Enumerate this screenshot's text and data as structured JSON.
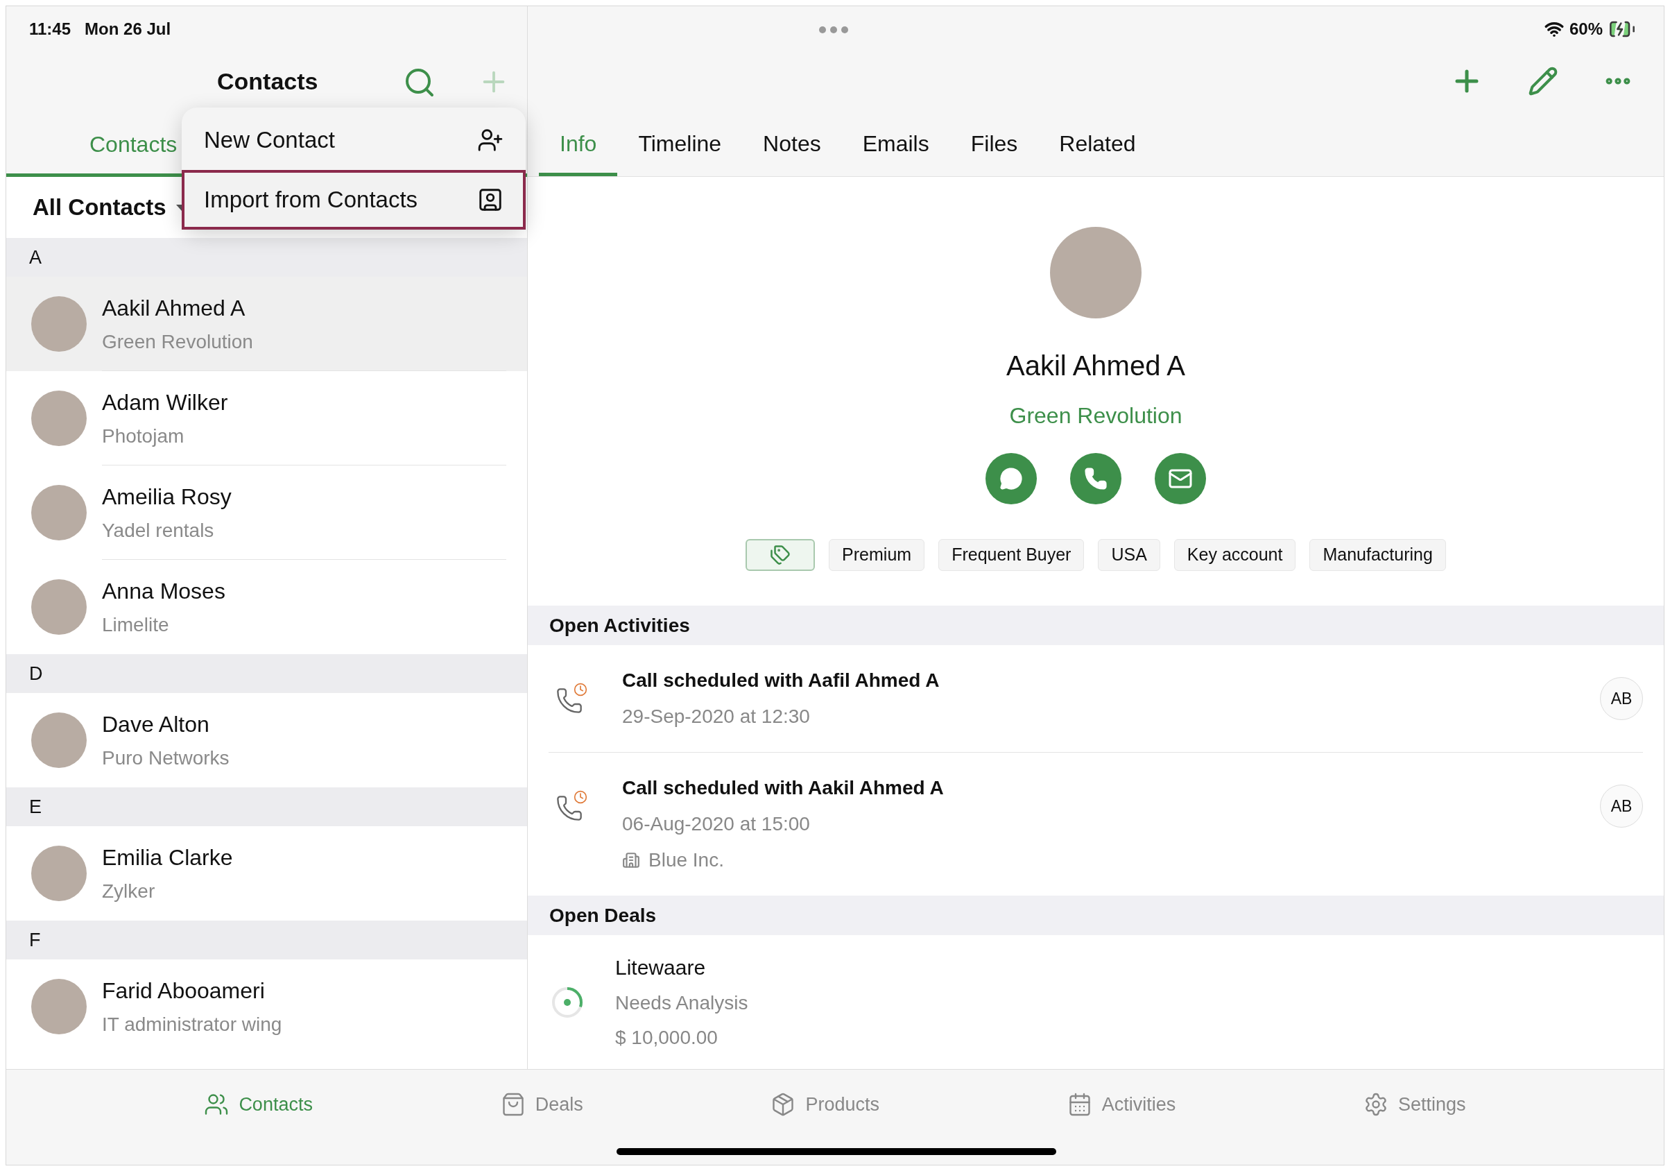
{
  "status_bar": {
    "time": "11:45",
    "date": "Mon 26 Jul",
    "battery": "60%"
  },
  "list_pane": {
    "title": "Contacts",
    "tabs": [
      {
        "label": "Contacts",
        "selected": true
      }
    ],
    "filter": "All Contacts",
    "sections": [
      {
        "letter": "A",
        "contacts": [
          {
            "name": "Aakil Ahmed A",
            "company": "Green Revolution",
            "selected": true
          },
          {
            "name": "Adam Wilker",
            "company": "Photojam",
            "selected": false
          },
          {
            "name": "Ameilia Rosy",
            "company": "Yadel rentals",
            "selected": false
          },
          {
            "name": "Anna Moses",
            "company": "Limelite",
            "selected": false
          }
        ]
      },
      {
        "letter": "D",
        "contacts": [
          {
            "name": "Dave Alton",
            "company": "Puro Networks",
            "selected": false
          }
        ]
      },
      {
        "letter": "E",
        "contacts": [
          {
            "name": "Emilia Clarke",
            "company": "Zylker",
            "selected": false
          }
        ]
      },
      {
        "letter": "F",
        "contacts": [
          {
            "name": "Farid Abooameri",
            "company": "IT administrator wing",
            "selected": false
          }
        ]
      }
    ]
  },
  "add_menu": {
    "items": [
      {
        "label": "New Contact",
        "selected": false
      },
      {
        "label": "Import from Contacts",
        "selected": true
      }
    ]
  },
  "detail_pane": {
    "tabs": [
      {
        "label": "Info",
        "selected": true
      },
      {
        "label": "Timeline",
        "selected": false
      },
      {
        "label": "Notes",
        "selected": false
      },
      {
        "label": "Emails",
        "selected": false
      },
      {
        "label": "Files",
        "selected": false
      },
      {
        "label": "Related",
        "selected": false
      }
    ],
    "name": "Aakil Ahmed A",
    "company": "Green Revolution",
    "tags": [
      "Premium",
      "Frequent Buyer",
      "USA",
      "Key account",
      "Manufacturing"
    ],
    "open_activities": {
      "title": "Open Activities",
      "items": [
        {
          "title": "Call scheduled with Aafil Ahmed A",
          "when": "29-Sep-2020 at 12:30",
          "owner": "AB"
        },
        {
          "title": "Call scheduled with Aakil Ahmed A",
          "when": "06-Aug-2020 at 15:00",
          "account": "Blue Inc.",
          "owner": "AB"
        }
      ]
    },
    "open_deals": {
      "title": "Open Deals",
      "items": [
        {
          "name": "Litewaare",
          "stage": "Needs Analysis",
          "amount": "$ 10,000.00",
          "level": 0.3
        }
      ]
    }
  },
  "bottom_tabs": [
    {
      "label": "Contacts",
      "selected": true
    },
    {
      "label": "Deals",
      "selected": false
    },
    {
      "label": "Products",
      "selected": false
    },
    {
      "label": "Activities",
      "selected": false
    },
    {
      "label": "Settings",
      "selected": false
    }
  ]
}
